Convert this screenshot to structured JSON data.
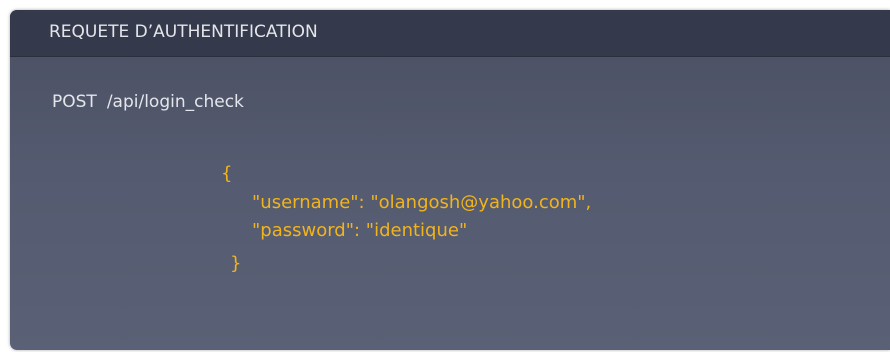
{
  "panel": {
    "title": "REQUETE D’AUTHENTIFICATION"
  },
  "request": {
    "method": "POST",
    "path": "/api/login_check"
  },
  "body": {
    "open_brace": "{",
    "username_line": "\"username\": \"olangosh@yahoo.com\",",
    "password_line": "\"password\": \"identique\"",
    "close_brace": "}"
  },
  "colors": {
    "header_bg": "#343a4b",
    "panel_bg": "#545a6f",
    "json_text": "#f2b41c",
    "text": "#e4e6eb"
  }
}
